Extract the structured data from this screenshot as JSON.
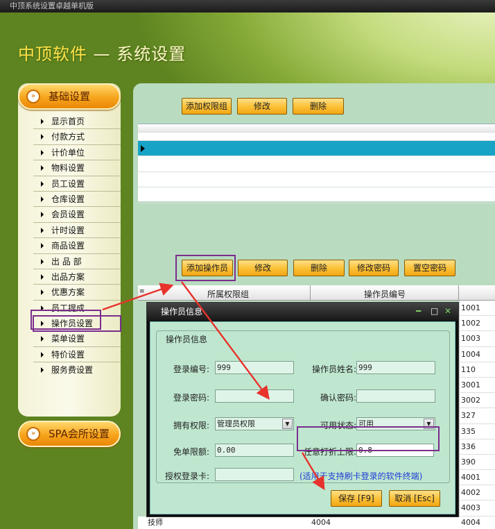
{
  "window": {
    "title": "中顶系统设置卓越单机版"
  },
  "header": {
    "brand": "中顶软件",
    "title": "系统设置",
    "sep": "—"
  },
  "sidebar": {
    "category": "基础设置",
    "category2": "SPA会所设置",
    "items": [
      "显示首页",
      "付款方式",
      "计价单位",
      "物料设置",
      "员工设置",
      "仓库设置",
      "会员设置",
      "计时设置",
      "商品设置",
      "出 品 部",
      "出品方案",
      "优惠方案",
      "员工提成",
      "操作员设置",
      "菜单设置",
      "特价设置",
      "服务费设置"
    ],
    "selected": "操作员设置"
  },
  "toolbar1": {
    "add": "添加权限组",
    "edit": "修改",
    "delete": "删除"
  },
  "toolbar2": {
    "add": "添加操作员",
    "edit": "修改",
    "delete": "删除",
    "change_pwd": "修改密码",
    "clear_pwd": "置空密码"
  },
  "grid2": {
    "col1": "所属权限组",
    "col2": "操作员编号",
    "ids": [
      "1001",
      "1002",
      "1003",
      "1004",
      "110",
      "3001",
      "3002",
      "327",
      "335",
      "336",
      "390",
      "4001",
      "4002",
      "4003"
    ],
    "last_row": {
      "group": "技师",
      "code": "4004",
      "id": "4004"
    }
  },
  "dialog": {
    "title": "操作员信息",
    "group": "操作员信息",
    "login_no_label": "登录编号:",
    "login_no": "999",
    "name_label": "操作员姓名:",
    "name": "999",
    "pwd_label": "登录密码:",
    "pwd": "",
    "confirm_label": "确认密码:",
    "confirm": "",
    "perm_label": "拥有权限:",
    "perm": "管理员权限",
    "status_label": "可用状态:",
    "status": "可用",
    "free_label": "免单限额:",
    "free": "0.00",
    "discount_label": "任意打折上限:",
    "discount": "0.8",
    "card_label": "授权登录卡:",
    "card": "",
    "note": "(适用于支持刷卡登录的软件终端)",
    "save": "保存 [F9]",
    "cancel": "取消 [Esc]"
  },
  "colors": {
    "accent": "#f7a41c",
    "highlight": "#7a2d8d",
    "arrow": "#e8322c",
    "selected_row": "#16a3c6"
  }
}
